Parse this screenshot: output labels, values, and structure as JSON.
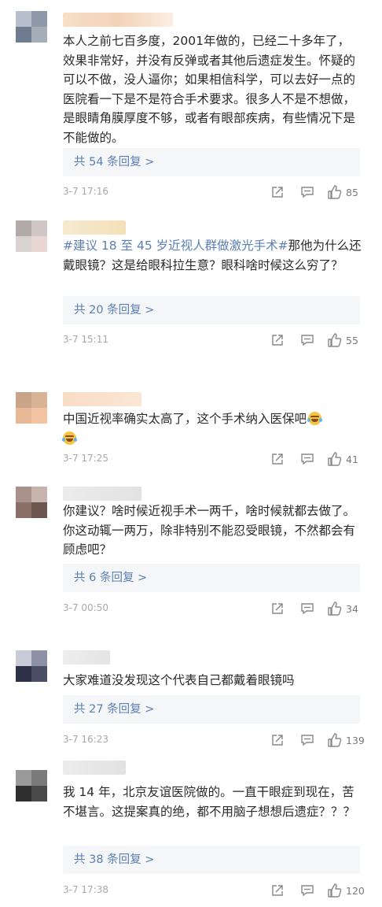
{
  "colors": {
    "link": "#5b7fb3",
    "meta": "#a8a8a8",
    "reply_bg": "#f5f6f8"
  },
  "comments": [
    {
      "text": "本人之前七百多度，2001年做的，已经二十多年了，效果非常好，并没有反弹或者其他后遗症发生。怀疑的可以不做，没人逼你；如果相信科学，可以去好一点的医院看一下是不是符合手术要求。很多人不是不想做，是眼睛角膜厚度不够，或者有眼部疾病，有些情况下是不能做的。",
      "replies": "共 54 条回复 >",
      "time": "3-7 17:16",
      "likes": "85"
    },
    {
      "tag": "#建议 18 至 45 岁近视人群做激光手术#",
      "text": "那他为什么还戴眼镜？这是给眼科拉生意？眼科啥时候这么穷了？",
      "replies": "共 20 条回复 >",
      "time": "3-7 15:11",
      "likes": "55"
    },
    {
      "text": "中国近视率确实太高了，这个手术纳入医保吧",
      "replies": "",
      "time": "3-7 17:25",
      "likes": "41"
    },
    {
      "text": "你建议？啥时候近视手术一两千，啥时候就都去做了。你这动辄一两万，除非特别不能忍受眼镜，不然都会有顾虑吧？",
      "replies": "共 6 条回复 >",
      "time": "3-7 00:50",
      "likes": "34"
    },
    {
      "text": "大家难道没发现这个代表自己都戴着眼镜吗",
      "replies": "共 27 条回复 >",
      "time": "3-7 16:23",
      "likes": "139"
    },
    {
      "text": "我 14 年，北京友谊医院做的。一直干眼症到现在，苦不堪言。这提案真的绝，都不用脑子想想后遗症？？？",
      "replies": "共 38 条回复 >",
      "time": "3-7 17:38",
      "likes": "120"
    }
  ]
}
